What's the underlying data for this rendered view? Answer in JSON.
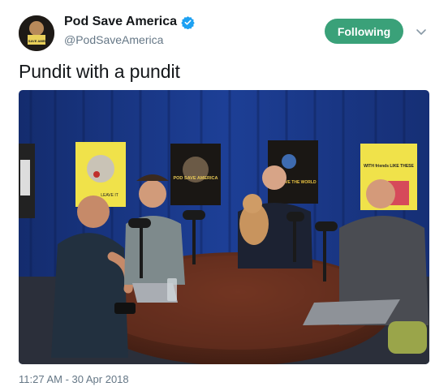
{
  "account": {
    "display_name": "Pod Save America",
    "handle": "@PodSaveAmerica",
    "verified": true,
    "avatar_text": "POD SAVE AMERICA"
  },
  "actions": {
    "follow_label": "Following"
  },
  "tweet": {
    "text": "Pundit with a pundit",
    "timestamp": "11:27 AM - 30 Apr 2018"
  },
  "photo": {
    "posters": [
      {
        "text": "LEAVE IT"
      },
      {
        "text": "POD SAVE AMERICA"
      },
      {
        "text": "POD SAVE THE WORLD"
      },
      {
        "text": "WITH friends LIKE THESE"
      }
    ]
  },
  "colors": {
    "accent": "#3aa179",
    "verified": "#1da1f2",
    "curtain": "#1b3a8c",
    "table": "#5a2a1c"
  }
}
